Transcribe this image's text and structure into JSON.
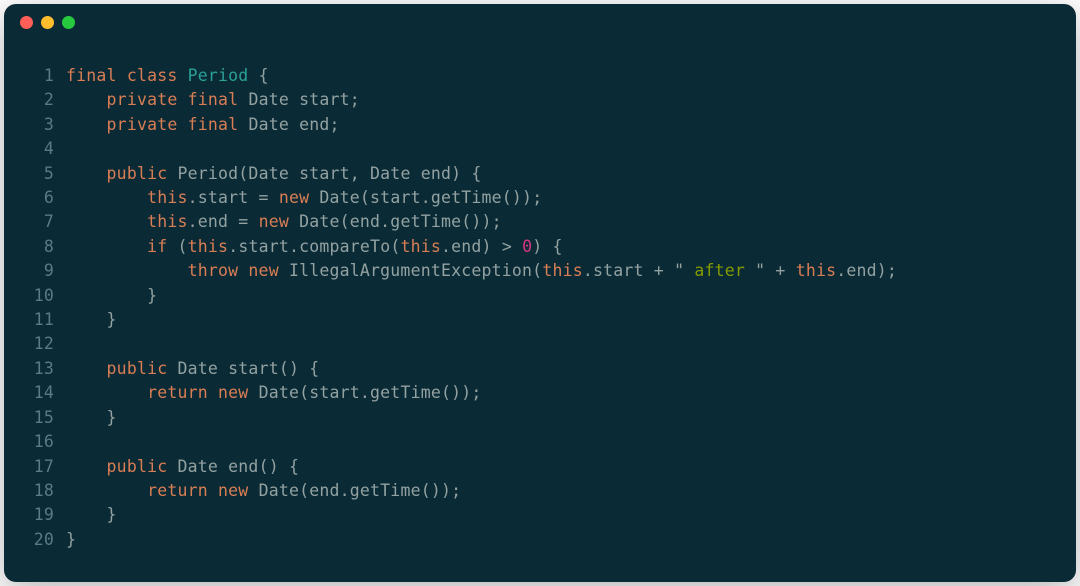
{
  "colors": {
    "background": "#0a2b36",
    "lineno": "#5a7a85",
    "keyword": "#d97d54",
    "type": "#2aa198",
    "default": "#93a1a1",
    "number": "#d33682",
    "string": "#859900"
  },
  "traffic_lights": {
    "red": "#ff5f56",
    "yellow": "#ffbd2e",
    "green": "#27c93f"
  },
  "code_lines": [
    {
      "n": 1,
      "tokens": [
        {
          "t": "final",
          "c": "kw"
        },
        {
          "t": " ",
          "c": "punct"
        },
        {
          "t": "class",
          "c": "kw"
        },
        {
          "t": " ",
          "c": "punct"
        },
        {
          "t": "Period",
          "c": "type"
        },
        {
          "t": " {",
          "c": "punct"
        }
      ]
    },
    {
      "n": 2,
      "tokens": [
        {
          "t": "    ",
          "c": "punct"
        },
        {
          "t": "private",
          "c": "kw"
        },
        {
          "t": " ",
          "c": "punct"
        },
        {
          "t": "final",
          "c": "kw"
        },
        {
          "t": " ",
          "c": "punct"
        },
        {
          "t": "Date start;",
          "c": "ident"
        }
      ]
    },
    {
      "n": 3,
      "tokens": [
        {
          "t": "    ",
          "c": "punct"
        },
        {
          "t": "private",
          "c": "kw"
        },
        {
          "t": " ",
          "c": "punct"
        },
        {
          "t": "final",
          "c": "kw"
        },
        {
          "t": " ",
          "c": "punct"
        },
        {
          "t": "Date end;",
          "c": "ident"
        }
      ]
    },
    {
      "n": 4,
      "tokens": []
    },
    {
      "n": 5,
      "tokens": [
        {
          "t": "    ",
          "c": "punct"
        },
        {
          "t": "public",
          "c": "kw"
        },
        {
          "t": " ",
          "c": "punct"
        },
        {
          "t": "Period(Date start, Date end) {",
          "c": "ident"
        }
      ]
    },
    {
      "n": 6,
      "tokens": [
        {
          "t": "        ",
          "c": "punct"
        },
        {
          "t": "this",
          "c": "kw"
        },
        {
          "t": ".start = ",
          "c": "ident"
        },
        {
          "t": "new",
          "c": "kw"
        },
        {
          "t": " Date(start.getTime());",
          "c": "ident"
        }
      ]
    },
    {
      "n": 7,
      "tokens": [
        {
          "t": "        ",
          "c": "punct"
        },
        {
          "t": "this",
          "c": "kw"
        },
        {
          "t": ".end = ",
          "c": "ident"
        },
        {
          "t": "new",
          "c": "kw"
        },
        {
          "t": " Date(end.getTime());",
          "c": "ident"
        }
      ]
    },
    {
      "n": 8,
      "tokens": [
        {
          "t": "        ",
          "c": "punct"
        },
        {
          "t": "if",
          "c": "kw"
        },
        {
          "t": " (",
          "c": "ident"
        },
        {
          "t": "this",
          "c": "kw"
        },
        {
          "t": ".start.compareTo(",
          "c": "ident"
        },
        {
          "t": "this",
          "c": "kw"
        },
        {
          "t": ".end) > ",
          "c": "ident"
        },
        {
          "t": "0",
          "c": "num"
        },
        {
          "t": ") {",
          "c": "ident"
        }
      ]
    },
    {
      "n": 9,
      "tokens": [
        {
          "t": "            ",
          "c": "punct"
        },
        {
          "t": "throw",
          "c": "kw"
        },
        {
          "t": " ",
          "c": "punct"
        },
        {
          "t": "new",
          "c": "kw"
        },
        {
          "t": " IllegalArgumentException(",
          "c": "ident"
        },
        {
          "t": "this",
          "c": "kw"
        },
        {
          "t": ".start + ",
          "c": "ident"
        },
        {
          "t": "\"",
          "c": "strq"
        },
        {
          "t": " after ",
          "c": "str"
        },
        {
          "t": "\"",
          "c": "strq"
        },
        {
          "t": " + ",
          "c": "ident"
        },
        {
          "t": "this",
          "c": "kw"
        },
        {
          "t": ".end);",
          "c": "ident"
        }
      ]
    },
    {
      "n": 10,
      "tokens": [
        {
          "t": "        }",
          "c": "ident"
        }
      ]
    },
    {
      "n": 11,
      "tokens": [
        {
          "t": "    }",
          "c": "ident"
        }
      ]
    },
    {
      "n": 12,
      "tokens": []
    },
    {
      "n": 13,
      "tokens": [
        {
          "t": "    ",
          "c": "punct"
        },
        {
          "t": "public",
          "c": "kw"
        },
        {
          "t": " ",
          "c": "punct"
        },
        {
          "t": "Date start() {",
          "c": "ident"
        }
      ]
    },
    {
      "n": 14,
      "tokens": [
        {
          "t": "        ",
          "c": "punct"
        },
        {
          "t": "return",
          "c": "kw"
        },
        {
          "t": " ",
          "c": "punct"
        },
        {
          "t": "new",
          "c": "kw"
        },
        {
          "t": " Date(start.getTime());",
          "c": "ident"
        }
      ]
    },
    {
      "n": 15,
      "tokens": [
        {
          "t": "    }",
          "c": "ident"
        }
      ]
    },
    {
      "n": 16,
      "tokens": []
    },
    {
      "n": 17,
      "tokens": [
        {
          "t": "    ",
          "c": "punct"
        },
        {
          "t": "public",
          "c": "kw"
        },
        {
          "t": " ",
          "c": "punct"
        },
        {
          "t": "Date end() {",
          "c": "ident"
        }
      ]
    },
    {
      "n": 18,
      "tokens": [
        {
          "t": "        ",
          "c": "punct"
        },
        {
          "t": "return",
          "c": "kw"
        },
        {
          "t": " ",
          "c": "punct"
        },
        {
          "t": "new",
          "c": "kw"
        },
        {
          "t": " Date(end.getTime());",
          "c": "ident"
        }
      ]
    },
    {
      "n": 19,
      "tokens": [
        {
          "t": "    }",
          "c": "ident"
        }
      ]
    },
    {
      "n": 20,
      "tokens": [
        {
          "t": "}",
          "c": "ident"
        }
      ]
    }
  ]
}
